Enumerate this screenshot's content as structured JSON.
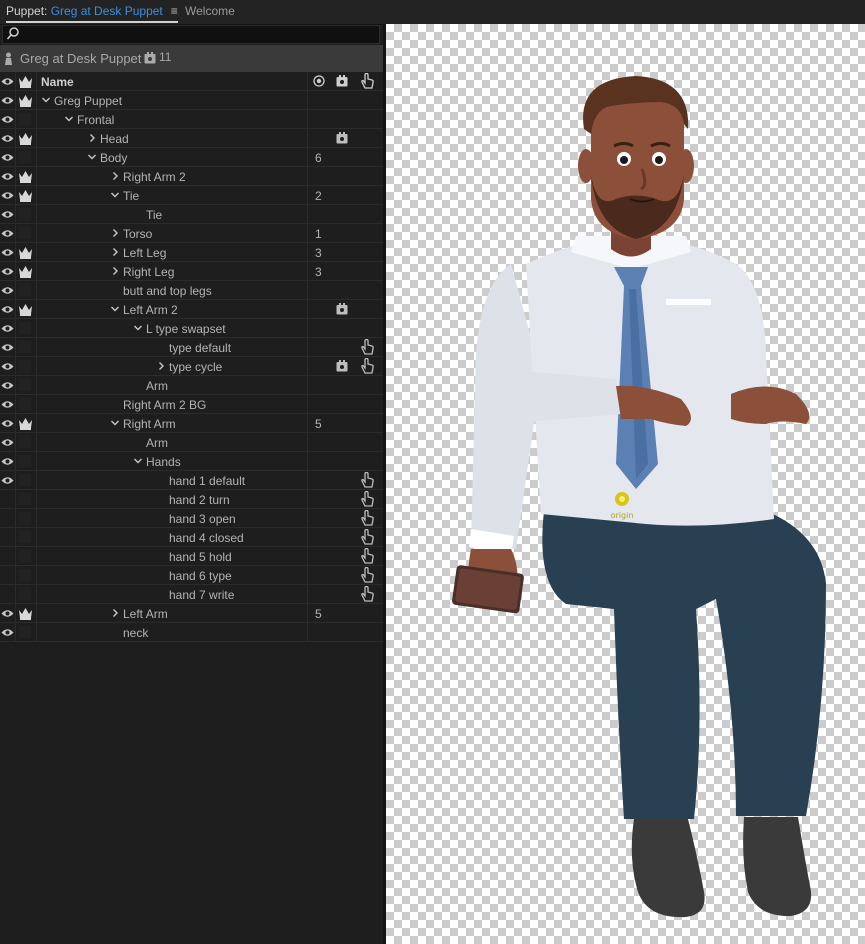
{
  "tabs": {
    "active_prefix": "Puppet: ",
    "active_name": "Greg at Desk Puppet",
    "menu_glyph": "≡",
    "second": "Welcome"
  },
  "search": {
    "placeholder": "",
    "value": ""
  },
  "puppet_bar": {
    "title": "Greg at Desk Puppet",
    "count": "11"
  },
  "header": {
    "name": "Name"
  },
  "rows": [
    {
      "label": "Greg Puppet",
      "indent": 0,
      "chev": "down",
      "eye": true,
      "crown": true,
      "count": "",
      "cam": false,
      "hand": false
    },
    {
      "label": "Frontal",
      "indent": 1,
      "chev": "down",
      "eye": true,
      "crown": false,
      "count": "",
      "cam": false,
      "hand": false
    },
    {
      "label": "Head",
      "indent": 2,
      "chev": "right",
      "eye": true,
      "crown": true,
      "count": "",
      "cam": true,
      "hand": false
    },
    {
      "label": "Body",
      "indent": 2,
      "chev": "down",
      "eye": true,
      "crown": false,
      "count": "6",
      "cam": false,
      "hand": false
    },
    {
      "label": "Right Arm 2",
      "indent": 3,
      "chev": "right",
      "eye": true,
      "crown": true,
      "count": "",
      "cam": false,
      "hand": false
    },
    {
      "label": "Tie",
      "indent": 3,
      "chev": "down",
      "eye": true,
      "crown": true,
      "count": "2",
      "cam": false,
      "hand": false
    },
    {
      "label": "Tie",
      "indent": 4,
      "chev": "none",
      "eye": true,
      "crown": false,
      "count": "",
      "cam": false,
      "hand": false
    },
    {
      "label": "Torso",
      "indent": 3,
      "chev": "right",
      "eye": true,
      "crown": false,
      "count": "1",
      "cam": false,
      "hand": false
    },
    {
      "label": "Left Leg",
      "indent": 3,
      "chev": "right",
      "eye": true,
      "crown": true,
      "count": "3",
      "cam": false,
      "hand": false
    },
    {
      "label": "Right Leg",
      "indent": 3,
      "chev": "right",
      "eye": true,
      "crown": true,
      "count": "3",
      "cam": false,
      "hand": false
    },
    {
      "label": "butt and top legs",
      "indent": 3,
      "chev": "none",
      "eye": true,
      "crown": false,
      "count": "",
      "cam": false,
      "hand": false
    },
    {
      "label": "Left Arm 2",
      "indent": 3,
      "chev": "down",
      "eye": true,
      "crown": true,
      "count": "",
      "cam": true,
      "hand": false
    },
    {
      "label": "L type swapset",
      "indent": 4,
      "chev": "down",
      "eye": true,
      "crown": false,
      "count": "",
      "cam": false,
      "hand": false
    },
    {
      "label": "type default",
      "indent": 5,
      "chev": "none",
      "eye": true,
      "crown": false,
      "count": "",
      "cam": false,
      "hand": true
    },
    {
      "label": "type cycle",
      "indent": 5,
      "chev": "right",
      "eye": true,
      "crown": false,
      "count": "",
      "cam": true,
      "hand": true
    },
    {
      "label": "Arm",
      "indent": 4,
      "chev": "none",
      "eye": true,
      "crown": false,
      "count": "",
      "cam": false,
      "hand": false
    },
    {
      "label": "Right Arm 2 BG",
      "indent": 3,
      "chev": "none",
      "eye": true,
      "crown": false,
      "count": "",
      "cam": false,
      "hand": false
    },
    {
      "label": "Right Arm",
      "indent": 3,
      "chev": "down",
      "eye": true,
      "crown": true,
      "count": "5",
      "cam": false,
      "hand": false
    },
    {
      "label": "Arm",
      "indent": 4,
      "chev": "none",
      "eye": true,
      "crown": false,
      "count": "",
      "cam": false,
      "hand": false
    },
    {
      "label": "Hands",
      "indent": 4,
      "chev": "down",
      "eye": true,
      "crown": false,
      "count": "",
      "cam": false,
      "hand": false
    },
    {
      "label": "hand 1 default",
      "indent": 5,
      "chev": "none",
      "eye": true,
      "crown": false,
      "count": "",
      "cam": false,
      "hand": true
    },
    {
      "label": "hand 2 turn",
      "indent": 5,
      "chev": "none",
      "eye": false,
      "crown": false,
      "count": "",
      "cam": false,
      "hand": true
    },
    {
      "label": "hand 3 open",
      "indent": 5,
      "chev": "none",
      "eye": false,
      "crown": false,
      "count": "",
      "cam": false,
      "hand": true
    },
    {
      "label": "hand 4 closed",
      "indent": 5,
      "chev": "none",
      "eye": false,
      "crown": false,
      "count": "",
      "cam": false,
      "hand": true
    },
    {
      "label": "hand 5 hold",
      "indent": 5,
      "chev": "none",
      "eye": false,
      "crown": false,
      "count": "",
      "cam": false,
      "hand": true
    },
    {
      "label": "hand 6 type",
      "indent": 5,
      "chev": "none",
      "eye": false,
      "crown": false,
      "count": "",
      "cam": false,
      "hand": true
    },
    {
      "label": "hand 7 write",
      "indent": 5,
      "chev": "none",
      "eye": false,
      "crown": false,
      "count": "",
      "cam": false,
      "hand": true
    },
    {
      "label": "Left Arm",
      "indent": 3,
      "chev": "right",
      "eye": true,
      "crown": true,
      "count": "5",
      "cam": false,
      "hand": false
    },
    {
      "label": "neck",
      "indent": 3,
      "chev": "none",
      "eye": true,
      "crown": false,
      "count": "",
      "cam": false,
      "hand": false
    }
  ],
  "viewer": {
    "origin_label": "origin"
  },
  "colors": {
    "accent": "#3b8fe0",
    "panel_bg": "#1e1e1e",
    "shirt": "#e4e8ee",
    "tie": "#5b80b4",
    "pants": "#293f52",
    "skin": "#8c4f3a",
    "hair": "#5a3220"
  }
}
